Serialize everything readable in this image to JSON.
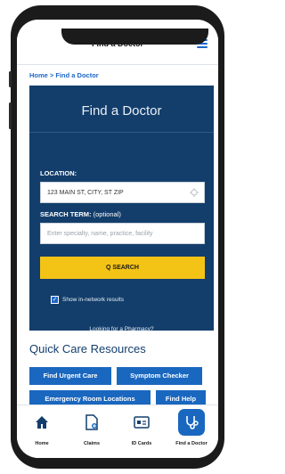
{
  "header": {
    "title": "Find a Doctor"
  },
  "breadcrumb": "Home > Find a Doctor",
  "panel": {
    "title": "Find a Doctor",
    "location_label": "LOCATION:",
    "location_value": "123 MAIN ST, CITY, ST ZIP",
    "search_term_label": "SEARCH TERM:",
    "search_term_optional": "(optional)",
    "search_placeholder": "Enter specialty, name, practice, facility",
    "search_button": "Q SEARCH",
    "checkbox_label": "Show in-network results",
    "checkbox_checked": true,
    "pharmacy_link": "Looking for a Pharmacy?"
  },
  "quick_care": {
    "title": "Quick Care Resources",
    "buttons": [
      "Find Urgent Care",
      "Symptom Checker",
      "Emergency Room Locations",
      "Find Help"
    ]
  },
  "nav": {
    "items": [
      {
        "label": "Home",
        "icon": "home-icon"
      },
      {
        "label": "Claims",
        "icon": "claims-document-icon"
      },
      {
        "label": "ID Cards",
        "icon": "id-card-icon"
      },
      {
        "label": "Find a Doctor",
        "icon": "stethoscope-icon"
      }
    ],
    "active": "Find a Doctor"
  },
  "colors": {
    "primary": "#1a67bf",
    "panel": "#133e6b",
    "search": "#f3c316"
  }
}
